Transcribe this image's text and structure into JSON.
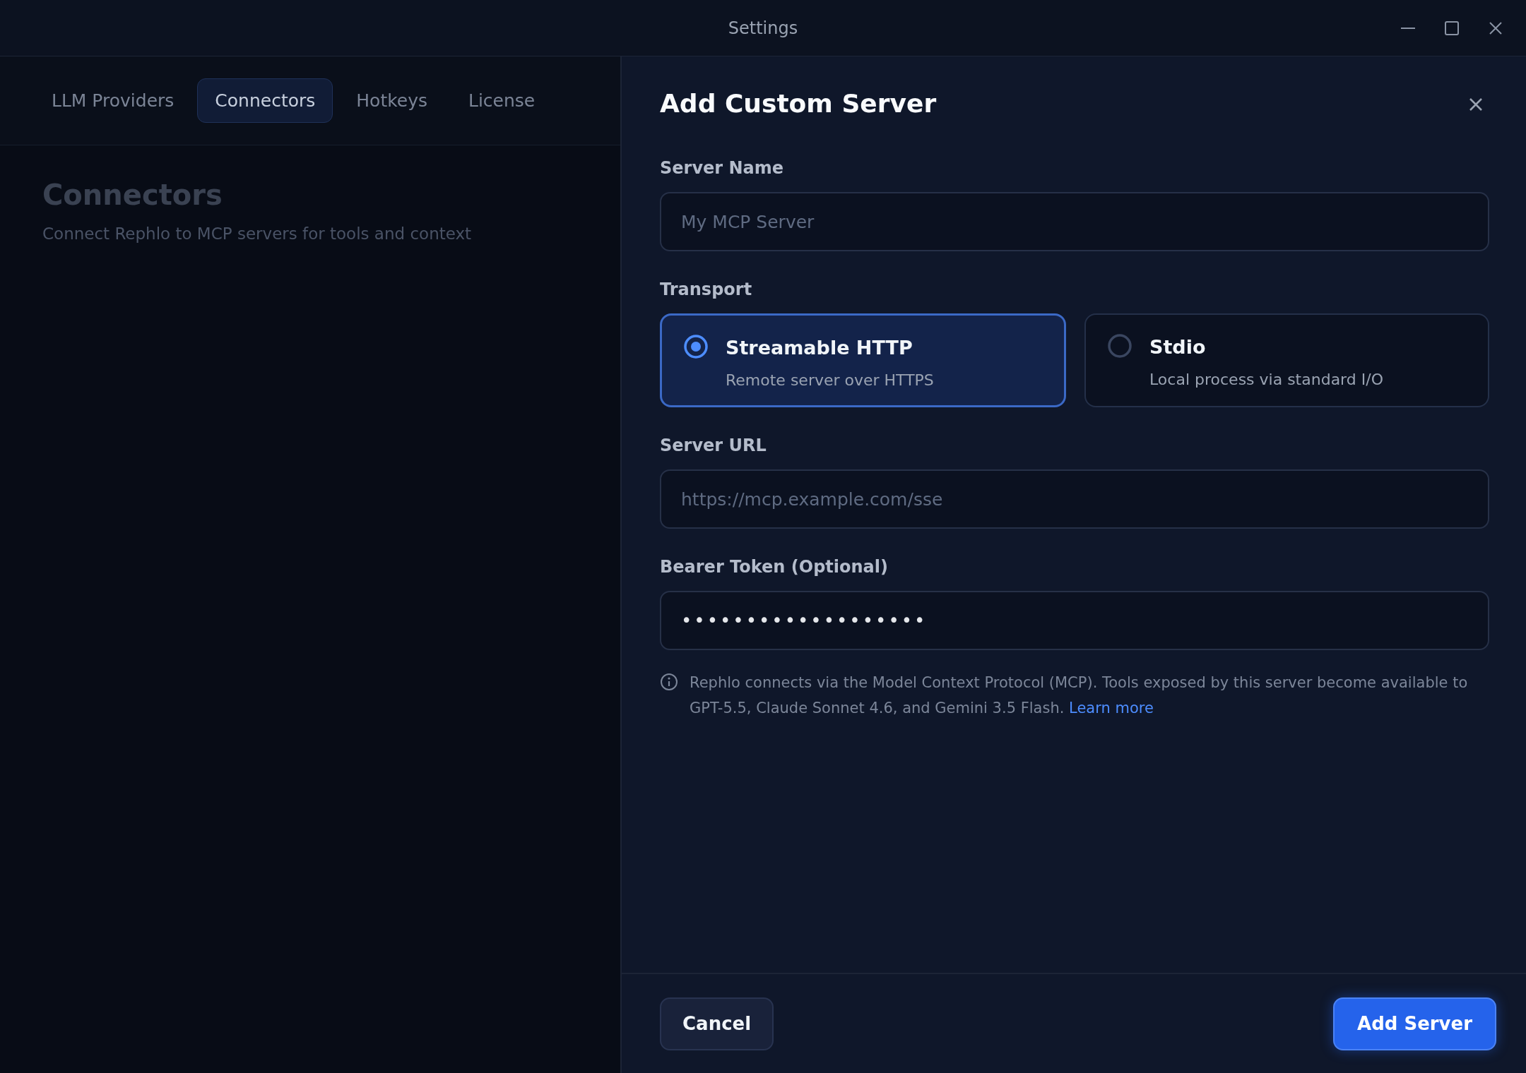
{
  "window": {
    "title": "Settings"
  },
  "tabs": [
    {
      "label": "LLM Providers",
      "selected": false
    },
    {
      "label": "Connectors",
      "selected": true
    },
    {
      "label": "Hotkeys",
      "selected": false
    },
    {
      "label": "License",
      "selected": false
    }
  ],
  "background_page": {
    "heading": "Connectors",
    "subtitle": "Connect Rephlo to MCP servers for tools and context"
  },
  "dialog": {
    "title": "Add Custom Server",
    "server_name": {
      "label": "Server Name",
      "placeholder": "My MCP Server"
    },
    "transport": {
      "label": "Transport",
      "options": [
        {
          "title": "Streamable HTTP",
          "description": "Remote server over HTTPS",
          "selected": true
        },
        {
          "title": "Stdio",
          "description": "Local process via standard I/O",
          "selected": false
        }
      ]
    },
    "server_url": {
      "label": "Server URL",
      "placeholder": "https://mcp.example.com/sse"
    },
    "bearer_token": {
      "label": "Bearer Token (Optional)",
      "value": "•••••••••••••••••••"
    },
    "info": {
      "text": "Rephlo connects via the Model Context Protocol (MCP). Tools exposed by this server become available to GPT-5.5, Claude Sonnet 4.6, and Gemini 3.5 Flash.",
      "link": "Learn more"
    },
    "buttons": [
      {
        "label": "Cancel",
        "kind": "secondary"
      },
      {
        "label": "Add Server",
        "kind": "primary"
      }
    ]
  }
}
